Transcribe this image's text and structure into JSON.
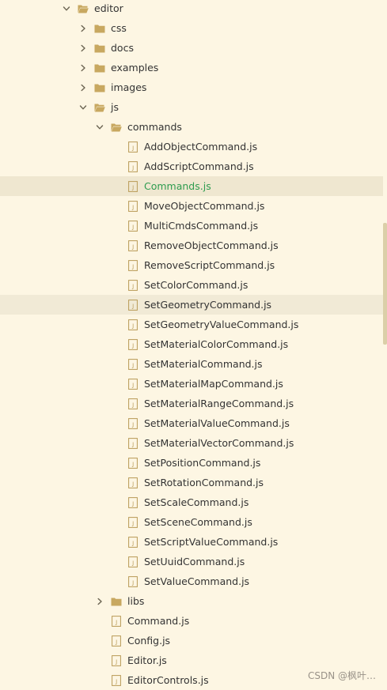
{
  "colors": {
    "background": "#fdf6e3",
    "folder": "#c8a860",
    "file_outline": "#b89a56",
    "active_text": "#2e9c4f",
    "text": "#333333"
  },
  "file_tree": [
    {
      "label": "editor",
      "type": "folder",
      "depth": 0,
      "expanded": true,
      "icon": "folder-open-icon",
      "name": "editor"
    },
    {
      "label": "css",
      "type": "folder",
      "depth": 1,
      "expanded": false,
      "icon": "folder-icon",
      "name": "css"
    },
    {
      "label": "docs",
      "type": "folder",
      "depth": 1,
      "expanded": false,
      "icon": "folder-icon",
      "name": "docs"
    },
    {
      "label": "examples",
      "type": "folder",
      "depth": 1,
      "expanded": false,
      "icon": "folder-icon",
      "name": "examples"
    },
    {
      "label": "images",
      "type": "folder",
      "depth": 1,
      "expanded": false,
      "icon": "folder-icon",
      "name": "images"
    },
    {
      "label": "js",
      "type": "folder",
      "depth": 1,
      "expanded": true,
      "icon": "folder-open-icon",
      "name": "js"
    },
    {
      "label": "commands",
      "type": "folder",
      "depth": 2,
      "expanded": true,
      "icon": "folder-open-icon",
      "name": "commands"
    },
    {
      "label": "AddObjectCommand.js",
      "type": "file",
      "depth": 3,
      "icon": "js-file-icon",
      "name": "addobjectcommand-js"
    },
    {
      "label": "AddScriptCommand.js",
      "type": "file",
      "depth": 3,
      "icon": "js-file-icon",
      "name": "addscriptcommand-js"
    },
    {
      "label": "Commands.js",
      "type": "file",
      "depth": 3,
      "icon": "js-file-icon",
      "name": "commands-js",
      "state": "active"
    },
    {
      "label": "MoveObjectCommand.js",
      "type": "file",
      "depth": 3,
      "icon": "js-file-icon",
      "name": "moveobjectcommand-js"
    },
    {
      "label": "MultiCmdsCommand.js",
      "type": "file",
      "depth": 3,
      "icon": "js-file-icon",
      "name": "multicmdscommand-js"
    },
    {
      "label": "RemoveObjectCommand.js",
      "type": "file",
      "depth": 3,
      "icon": "js-file-icon",
      "name": "removeobjectcommand-js"
    },
    {
      "label": "RemoveScriptCommand.js",
      "type": "file",
      "depth": 3,
      "icon": "js-file-icon",
      "name": "removescriptcommand-js"
    },
    {
      "label": "SetColorCommand.js",
      "type": "file",
      "depth": 3,
      "icon": "js-file-icon",
      "name": "setcolorcommand-js"
    },
    {
      "label": "SetGeometryCommand.js",
      "type": "file",
      "depth": 3,
      "icon": "js-file-icon",
      "name": "setgeometrycommand-js",
      "state": "hover"
    },
    {
      "label": "SetGeometryValueCommand.js",
      "type": "file",
      "depth": 3,
      "icon": "js-file-icon",
      "name": "setgeometryvaluecommand-js"
    },
    {
      "label": "SetMaterialColorCommand.js",
      "type": "file",
      "depth": 3,
      "icon": "js-file-icon",
      "name": "setmaterialcolorcommand-js"
    },
    {
      "label": "SetMaterialCommand.js",
      "type": "file",
      "depth": 3,
      "icon": "js-file-icon",
      "name": "setmaterialcommand-js"
    },
    {
      "label": "SetMaterialMapCommand.js",
      "type": "file",
      "depth": 3,
      "icon": "js-file-icon",
      "name": "setmaterialmapcommand-js"
    },
    {
      "label": "SetMaterialRangeCommand.js",
      "type": "file",
      "depth": 3,
      "icon": "js-file-icon",
      "name": "setmaterialrangecommand-js"
    },
    {
      "label": "SetMaterialValueCommand.js",
      "type": "file",
      "depth": 3,
      "icon": "js-file-icon",
      "name": "setmaterialvaluecommand-js"
    },
    {
      "label": "SetMaterialVectorCommand.js",
      "type": "file",
      "depth": 3,
      "icon": "js-file-icon",
      "name": "setmaterialvectorcommand-js"
    },
    {
      "label": "SetPositionCommand.js",
      "type": "file",
      "depth": 3,
      "icon": "js-file-icon",
      "name": "setpositioncommand-js"
    },
    {
      "label": "SetRotationCommand.js",
      "type": "file",
      "depth": 3,
      "icon": "js-file-icon",
      "name": "setrotationcommand-js"
    },
    {
      "label": "SetScaleCommand.js",
      "type": "file",
      "depth": 3,
      "icon": "js-file-icon",
      "name": "setscalecommand-js"
    },
    {
      "label": "SetSceneCommand.js",
      "type": "file",
      "depth": 3,
      "icon": "js-file-icon",
      "name": "setscenecommand-js"
    },
    {
      "label": "SetScriptValueCommand.js",
      "type": "file",
      "depth": 3,
      "icon": "js-file-icon",
      "name": "setscriptvaluecommand-js"
    },
    {
      "label": "SetUuidCommand.js",
      "type": "file",
      "depth": 3,
      "icon": "js-file-icon",
      "name": "setuuidcommand-js"
    },
    {
      "label": "SetValueCommand.js",
      "type": "file",
      "depth": 3,
      "icon": "js-file-icon",
      "name": "setvaluecommand-js"
    },
    {
      "label": "libs",
      "type": "folder",
      "depth": 2,
      "expanded": false,
      "icon": "folder-icon",
      "name": "libs"
    },
    {
      "label": "Command.js",
      "type": "file",
      "depth": 2,
      "icon": "js-file-icon",
      "name": "command-js"
    },
    {
      "label": "Config.js",
      "type": "file",
      "depth": 2,
      "icon": "js-file-icon",
      "name": "config-js"
    },
    {
      "label": "Editor.js",
      "type": "file",
      "depth": 2,
      "icon": "js-file-icon",
      "name": "editor-js"
    },
    {
      "label": "EditorControls.js",
      "type": "file",
      "depth": 2,
      "icon": "js-file-icon",
      "name": "editorcontrols-js"
    }
  ],
  "watermark": "CSDN @枫叶…"
}
